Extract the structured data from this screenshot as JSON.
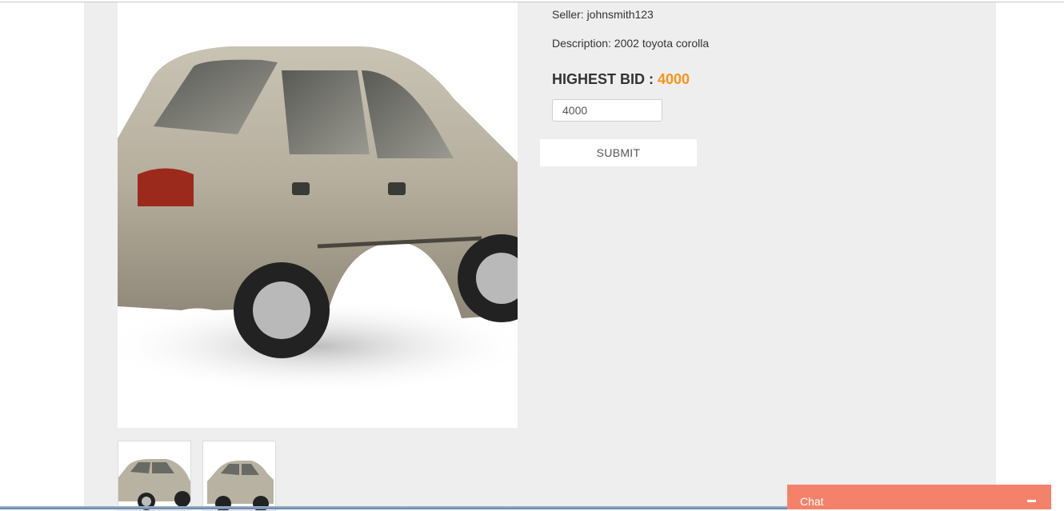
{
  "listing": {
    "seller_text": "Seller: johnsmith123",
    "description_text": "Description: 2002 toyota corolla",
    "highest_bid_label": "HIGHEST BID : ",
    "highest_bid_value": "4000",
    "bid_input_value": "4000",
    "submit_label": "SUBMIT",
    "bid_accent_color": "#f7941d"
  },
  "photos": {
    "main": "car-photo",
    "thumbnails": [
      "car-thumbnail",
      "car-thumbnail"
    ]
  },
  "chat": {
    "label": "Chat",
    "minimize_icon": "minus-icon",
    "color": "#f4826a"
  }
}
